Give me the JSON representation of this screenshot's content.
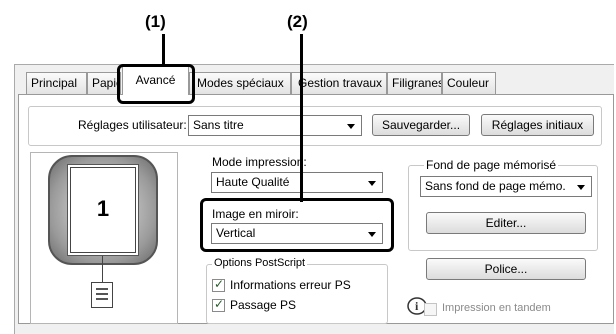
{
  "callouts": {
    "one": "(1)",
    "two": "(2)"
  },
  "tabs": [
    {
      "label": "Principal"
    },
    {
      "label": "Papier"
    },
    {
      "label": "Avancé"
    },
    {
      "label": "Modes spéciaux"
    },
    {
      "label": "Gestion travaux"
    },
    {
      "label": "Filigranes"
    },
    {
      "label": "Couleur"
    }
  ],
  "user_settings": {
    "label": "Réglages utilisateur:",
    "value": "Sans titre",
    "save_label": "Sauvegarder...",
    "initial_label": "Réglages initiaux"
  },
  "preview": {
    "page_number": "1"
  },
  "print_mode": {
    "label": "Mode impression:",
    "value": "Haute Qualité"
  },
  "mirror": {
    "label": "Image en miroir:",
    "value": "Vertical"
  },
  "postscript": {
    "label": "Options PostScript",
    "error_info": "Informations erreur PS",
    "passthrough": "Passage PS"
  },
  "overlay": {
    "label": "Fond de page mémorisé",
    "value": "Sans fond de page mémo.",
    "edit_label": "Editer..."
  },
  "font_button": "Police...",
  "tandem": "Impression en tandem"
}
